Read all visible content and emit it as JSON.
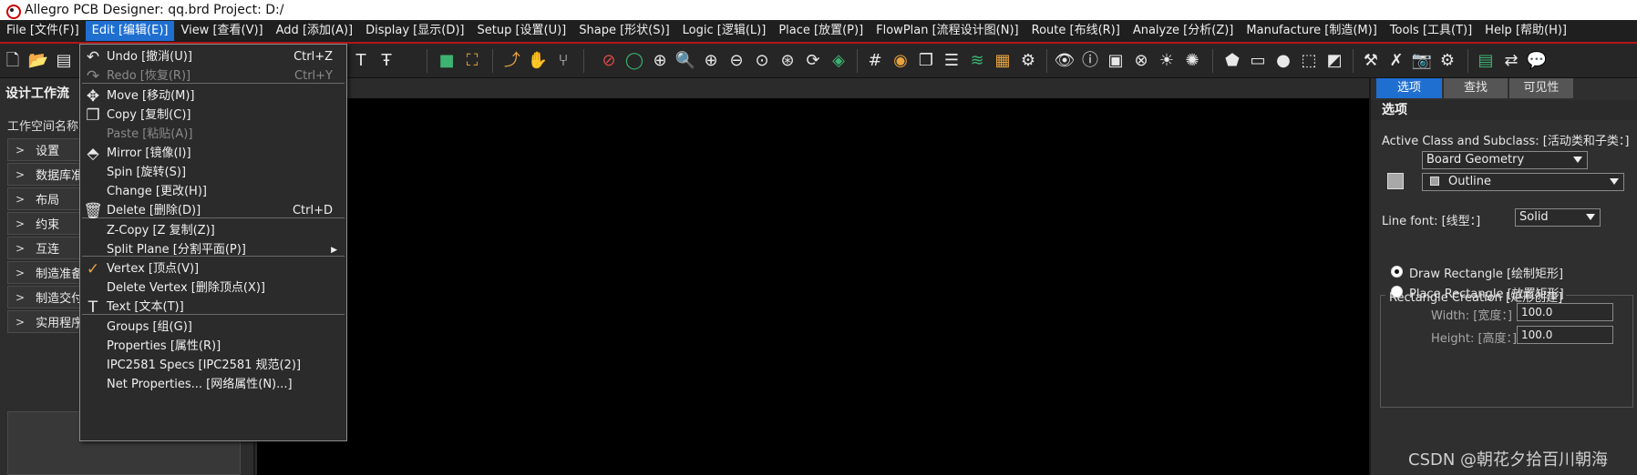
{
  "window": {
    "title": "Allegro PCB Designer: qq.brd  Project: D:/"
  },
  "menubar": {
    "items": [
      "File [文件(F)]",
      "Edit [编辑(E)]",
      "View [查看(V)]",
      "Add [添加(A)]",
      "Display [显示(D)]",
      "Setup [设置(U)]",
      "Shape [形状(S)]",
      "Logic [逻辑(L)]",
      "Place [放置(P)]",
      "FlowPlan [流程设计图(N)]",
      "Route [布线(R)]",
      "Analyze [分析(Z)]",
      "Manufacture [制造(M)]",
      "Tools [工具(T)]",
      "Help [帮助(H)]"
    ],
    "active_index": 1
  },
  "edit_menu": {
    "items": [
      {
        "label": "Undo [撤消(U)]",
        "shortcut": "Ctrl+Z",
        "icon": "undo-icon",
        "disabled": false
      },
      {
        "label": "Redo [恢复(R)]",
        "shortcut": "Ctrl+Y",
        "icon": "redo-icon",
        "disabled": true
      },
      {
        "label": "Move [移动(M)]",
        "shortcut": "",
        "icon": "move-icon",
        "disabled": false
      },
      {
        "label": "Copy [复制(C)]",
        "shortcut": "",
        "icon": "copy-icon",
        "disabled": false
      },
      {
        "label": "Paste [粘贴(A)]",
        "shortcut": "",
        "icon": "",
        "disabled": true
      },
      {
        "label": "Mirror [镜像(I)]",
        "shortcut": "",
        "icon": "mirror-icon",
        "disabled": false
      },
      {
        "label": "Spin [旋转(S)]",
        "shortcut": "",
        "icon": "",
        "disabled": false
      },
      {
        "label": "Change [更改(H)]",
        "shortcut": "",
        "icon": "",
        "disabled": false
      },
      {
        "label": "Delete [删除(D)]",
        "shortcut": "Ctrl+D",
        "icon": "delete-icon",
        "disabled": false
      },
      {
        "label": "Z-Copy [Z 复制(Z)]",
        "shortcut": "",
        "icon": "",
        "disabled": false
      },
      {
        "label": "Split Plane [分割平面(P)]",
        "shortcut": "",
        "icon": "",
        "disabled": false,
        "submenu": true
      },
      {
        "label": "Vertex [顶点(V)]",
        "shortcut": "",
        "icon": "vertex-icon",
        "disabled": false
      },
      {
        "label": "Delete Vertex [删除顶点(X)]",
        "shortcut": "",
        "icon": "",
        "disabled": false
      },
      {
        "label": "Text [文本(T)]",
        "shortcut": "",
        "icon": "text-icon",
        "disabled": false
      },
      {
        "label": "Groups [组(G)]",
        "shortcut": "",
        "icon": "",
        "disabled": false
      },
      {
        "label": "Properties [属性(R)]",
        "shortcut": "",
        "icon": "",
        "disabled": false
      },
      {
        "label": "IPC2581 Specs [IPC2581 规范(2)]",
        "shortcut": "",
        "icon": "",
        "disabled": false
      },
      {
        "label": "Net Properties... [网络属性(N)...]",
        "shortcut": "",
        "icon": "",
        "disabled": false
      }
    ]
  },
  "left_panel": {
    "title": "设计工作流",
    "workspace_label": "工作空间名称",
    "tree_items": [
      "设置",
      "数据库准备",
      "布局",
      "约束",
      "互连",
      "制造准备",
      "制造交付",
      "实用程序"
    ]
  },
  "right_panel": {
    "tabs": [
      "选项",
      "查找",
      "可见性"
    ],
    "active_tab": 0,
    "header": "选项",
    "active_class_label": "Active Class and Subclass: [活动类和子类：]",
    "class_value": "Board Geometry",
    "subclass_value": "Outline",
    "line_font_label": "Line font: [线型：]",
    "line_font_value": "Solid",
    "rect_group_title": "Rectangle Creation [矩形创建]",
    "draw_rect_label": "Draw Rectangle [绘制矩形]",
    "place_rect_label": "Place Rectangle [放置矩形]",
    "draw_rect_selected": true,
    "width_label": "Width: [宽度：]",
    "width_value": "100.0",
    "height_label": "Height: [高度：]",
    "height_value": "100.0"
  },
  "watermark": "CSDN @朝花夕拾百川朝海",
  "colors": {
    "accent": "#1f6fd1",
    "menubar_border": "#b3161b",
    "canvas": "#000000"
  }
}
